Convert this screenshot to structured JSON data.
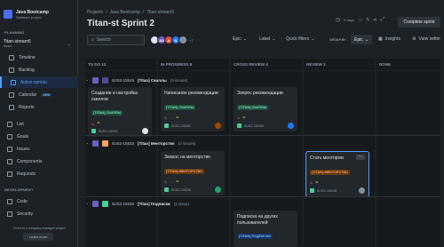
{
  "sidebar": {
    "project_name": "Java Bootcamp",
    "project_type": "Software project",
    "planning_title": "PLANNING",
    "board_name": "Titan-stream5",
    "board_type": "Board",
    "items": [
      {
        "label": "Timeline"
      },
      {
        "label": "Backlog"
      },
      {
        "label": "Active sprints"
      },
      {
        "label": "Calendar",
        "badge": "NEW"
      },
      {
        "label": "Reports"
      },
      {
        "label": "List"
      },
      {
        "label": "Goals"
      },
      {
        "label": "Issues"
      },
      {
        "label": "Components"
      },
      {
        "label": "Requests"
      }
    ],
    "development_title": "DEVELOPMENT",
    "dev_items": [
      {
        "label": "Code"
      },
      {
        "label": "Security"
      }
    ],
    "footer": "You're in a company-managed project",
    "learn_more": "Learn more"
  },
  "header": {
    "breadcrumbs": [
      "Projects",
      "/",
      "Java Bootcamp",
      "/",
      "Titan-stream5"
    ],
    "title": "Titan-st Sprint 2",
    "days_left": "5 days",
    "complete_sprint": "Complete sprint"
  },
  "toolbar": {
    "search_placeholder": "Search",
    "avatars": [
      {
        "initials": "",
        "color": "#dee4ea"
      },
      {
        "initials": "AD",
        "color": "#6e5dc6"
      },
      {
        "initials": "A",
        "color": "#e2483d"
      },
      {
        "initials": "B",
        "color": "#1d7afc"
      },
      {
        "initials": "",
        "color": "#8590a2"
      }
    ],
    "avatars_more": "+7",
    "filters": [
      "Epic",
      "Label",
      "Quick filters"
    ],
    "group_by_label": "GROUP BY",
    "group_by_value": "Epic",
    "insights": "Insights",
    "view_settings": "View settin"
  },
  "columns": [
    "TO DO 13",
    "IN PROGRESS 8",
    "CROSS REVIEW 4",
    "REVIEW 1",
    "DONE"
  ],
  "lanes": [
    {
      "key": "BJS2-15549",
      "name": "[Titan] Скиллы",
      "count": "(3 issues)",
      "color": "#6e5dc6"
    },
    {
      "key": "BJS2-15533",
      "name": "[Titan] Менторство",
      "count": "(2 issues)",
      "color": "#fea362"
    },
    {
      "key": "BJS2-15536",
      "name": "[Titan] Подписки",
      "count": "(1 issue)",
      "color": "#4bce97"
    }
  ],
  "cards": [
    {
      "title": "Создание и настройка скиллов",
      "tag": "[TITAN] СКИЛЛЫ",
      "key": "BJS2-15551"
    },
    {
      "title": "Написание рекомендации",
      "tag": "[TITAN] СКИЛЛЫ",
      "key": "BJS2-15552"
    },
    {
      "title": "Запрос рекомендации",
      "tag": "[TITAN] СКИЛЛЫ",
      "key": "BJS2-15550"
    },
    {
      "title": "Запрос на менторство",
      "tag": "[TITAN] МЕНТОРСТВО",
      "key": "BJS2-15534"
    },
    {
      "title": "Стать ментором",
      "tag": "[TITAN] МЕНТОРСТВО",
      "key": "BJS2-15535"
    },
    {
      "title": "Подписка на других пользователей",
      "tag": "[TITAN] ПОДПИСКИ",
      "key": ""
    }
  ],
  "colors": {
    "accent": "#579dff",
    "background": "#1d2125",
    "card": "#22272b"
  }
}
